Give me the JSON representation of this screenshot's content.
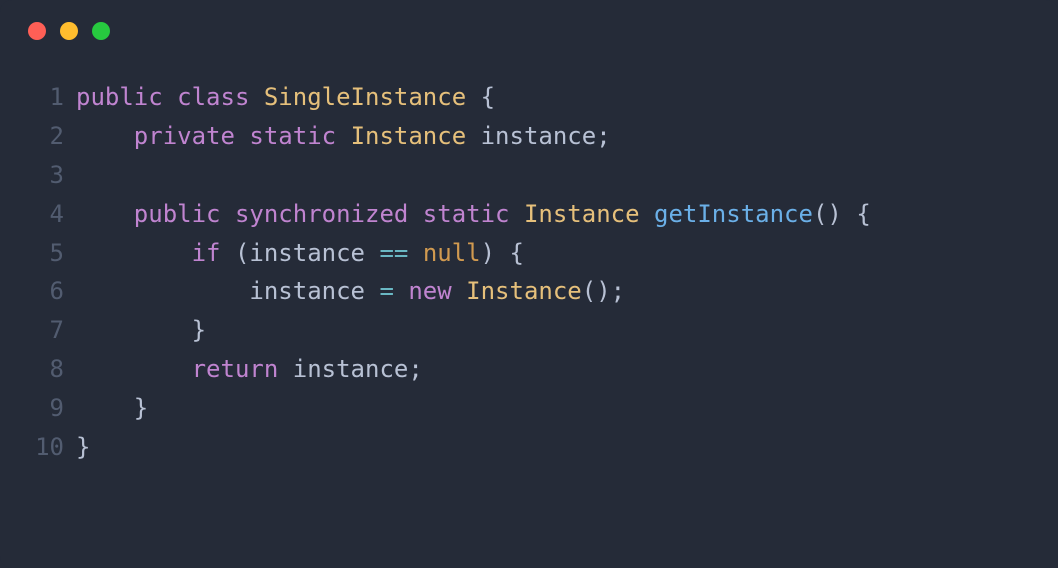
{
  "window_controls": {
    "close": "close",
    "minimize": "minimize",
    "maximize": "maximize"
  },
  "code": {
    "lines": [
      {
        "num": "1",
        "tokens": [
          {
            "cls": "kw",
            "t": "public"
          },
          {
            "cls": "punct",
            "t": " "
          },
          {
            "cls": "kw",
            "t": "class"
          },
          {
            "cls": "punct",
            "t": " "
          },
          {
            "cls": "type",
            "t": "SingleInstance"
          },
          {
            "cls": "punct",
            "t": " "
          },
          {
            "cls": "brace",
            "t": "{"
          }
        ]
      },
      {
        "num": "2",
        "tokens": [
          {
            "cls": "punct",
            "t": "    "
          },
          {
            "cls": "kw",
            "t": "private"
          },
          {
            "cls": "punct",
            "t": " "
          },
          {
            "cls": "kw",
            "t": "static"
          },
          {
            "cls": "punct",
            "t": " "
          },
          {
            "cls": "type",
            "t": "Instance"
          },
          {
            "cls": "punct",
            "t": " "
          },
          {
            "cls": "punct",
            "t": "instance;"
          }
        ]
      },
      {
        "num": "3",
        "tokens": []
      },
      {
        "num": "4",
        "tokens": [
          {
            "cls": "punct",
            "t": "    "
          },
          {
            "cls": "kw",
            "t": "public"
          },
          {
            "cls": "punct",
            "t": " "
          },
          {
            "cls": "kw",
            "t": "synchronized"
          },
          {
            "cls": "punct",
            "t": " "
          },
          {
            "cls": "kw",
            "t": "static"
          },
          {
            "cls": "punct",
            "t": " "
          },
          {
            "cls": "type",
            "t": "Instance"
          },
          {
            "cls": "punct",
            "t": " "
          },
          {
            "cls": "method",
            "t": "getInstance"
          },
          {
            "cls": "punct",
            "t": "() "
          },
          {
            "cls": "brace",
            "t": "{"
          }
        ]
      },
      {
        "num": "5",
        "tokens": [
          {
            "cls": "punct",
            "t": "        "
          },
          {
            "cls": "kw",
            "t": "if"
          },
          {
            "cls": "punct",
            "t": " (instance "
          },
          {
            "cls": "op",
            "t": "=="
          },
          {
            "cls": "punct",
            "t": " "
          },
          {
            "cls": "null",
            "t": "null"
          },
          {
            "cls": "punct",
            "t": ") "
          },
          {
            "cls": "brace",
            "t": "{"
          }
        ]
      },
      {
        "num": "6",
        "tokens": [
          {
            "cls": "punct",
            "t": "            instance "
          },
          {
            "cls": "op",
            "t": "="
          },
          {
            "cls": "punct",
            "t": " "
          },
          {
            "cls": "kw",
            "t": "new"
          },
          {
            "cls": "punct",
            "t": " "
          },
          {
            "cls": "type",
            "t": "Instance"
          },
          {
            "cls": "punct",
            "t": "();"
          }
        ]
      },
      {
        "num": "7",
        "tokens": [
          {
            "cls": "punct",
            "t": "        "
          },
          {
            "cls": "brace",
            "t": "}"
          }
        ]
      },
      {
        "num": "8",
        "tokens": [
          {
            "cls": "punct",
            "t": "        "
          },
          {
            "cls": "kw",
            "t": "return"
          },
          {
            "cls": "punct",
            "t": " instance;"
          }
        ]
      },
      {
        "num": "9",
        "tokens": [
          {
            "cls": "punct",
            "t": "    "
          },
          {
            "cls": "brace",
            "t": "}"
          }
        ]
      },
      {
        "num": "10",
        "tokens": [
          {
            "cls": "brace",
            "t": "}"
          }
        ]
      }
    ]
  }
}
